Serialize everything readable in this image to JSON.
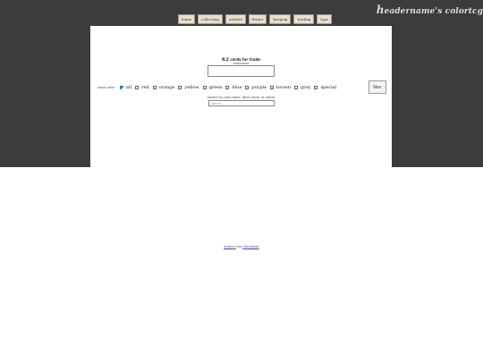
{
  "site_title": {
    "first_letter": "h",
    "rest": "eadername's colortcg"
  },
  "nav": [
    "home",
    "collecting",
    "needed",
    "future",
    "keeping",
    "trading",
    "logs"
  ],
  "panel": {
    "heading": "N.Z cards for trade",
    "subheading": "duplicates",
    "show_color_label": "show color:",
    "colors": [
      {
        "label": "all",
        "checked": true
      },
      {
        "label": "red",
        "checked": false
      },
      {
        "label": "orange",
        "checked": false
      },
      {
        "label": "yellow",
        "checked": false
      },
      {
        "label": "green",
        "checked": false
      },
      {
        "label": "blue",
        "checked": false
      },
      {
        "label": "purple",
        "checked": false
      },
      {
        "label": "brown",
        "checked": false
      },
      {
        "label": "grey",
        "checked": false
      },
      {
        "label": "special",
        "checked": false
      }
    ],
    "filter_button": "filter",
    "search_label": "search by card name, deck name, or series",
    "search_placeholder": "search..."
  },
  "footer": {
    "left_link": "source",
    "by": "by",
    "right_link": "elocation"
  },
  "colors": {
    "band": "#3c3c3c",
    "panel": "#ffffff",
    "checkbox_on": "#1a73e8"
  }
}
